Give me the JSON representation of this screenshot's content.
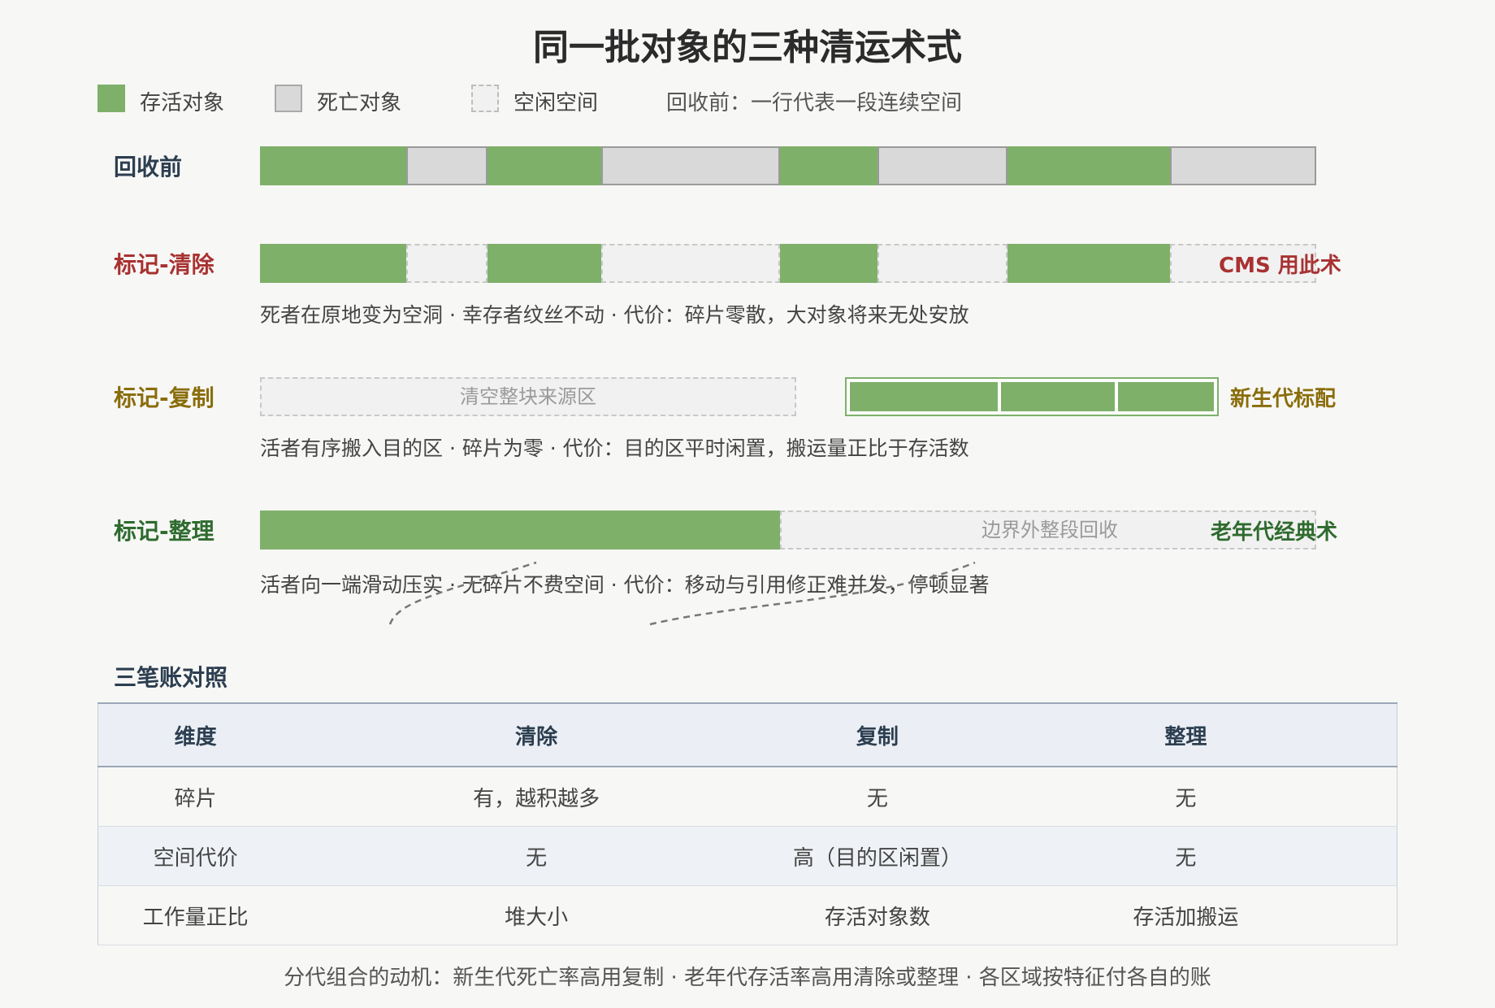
{
  "title": "同一批对象的三种清运术式",
  "legend": {
    "live": "存活对象",
    "dead": "死亡对象",
    "free": "空闲空间",
    "note": "回收前：一行代表一段连续空间"
  },
  "colors": {
    "live": "#7eb06a",
    "dead": "#d9d9d9",
    "free": "#f1f1f1",
    "sweep": "#a83232",
    "copy": "#8a6d0b",
    "compact": "#2e6b2e",
    "section": "#2c3e50"
  },
  "rows": {
    "before": {
      "label": "回收前"
    },
    "sweep": {
      "label": "标记-清除",
      "tag": "CMS 用此术",
      "desc": "死者在原地变为空洞 · 幸存者纹丝不动 · 代价：碎片零散，大对象将来无处安放"
    },
    "copy": {
      "label": "标记-复制",
      "source_label": "清空整块来源区",
      "tag": "新生代标配",
      "desc": "活者有序搬入目的区 · 碎片为零 · 代价：目的区平时闲置，搬运量正比于存活数"
    },
    "compact": {
      "label": "标记-整理",
      "free_label": "边界外整段回收",
      "tag": "老年代经典术",
      "desc": "活者向一端滑动压实 · 无碎片不费空间 · 代价：移动与引用修正难并发，停顿显著"
    }
  },
  "comparison": {
    "title": "三笔账对照",
    "headers": [
      "维度",
      "清除",
      "复制",
      "整理"
    ],
    "rows": [
      [
        "碎片",
        "有，越积越多",
        "无",
        "无"
      ],
      [
        "空间代价",
        "无",
        "高（目的区闲置）",
        "无"
      ],
      [
        "工作量正比",
        "堆大小",
        "存活对象数",
        "存活加搬运"
      ]
    ]
  },
  "footer": "分代组合的动机：新生代死亡率高用复制 · 老年代存活率高用清除或整理 · 各区域按特征付各自的账"
}
